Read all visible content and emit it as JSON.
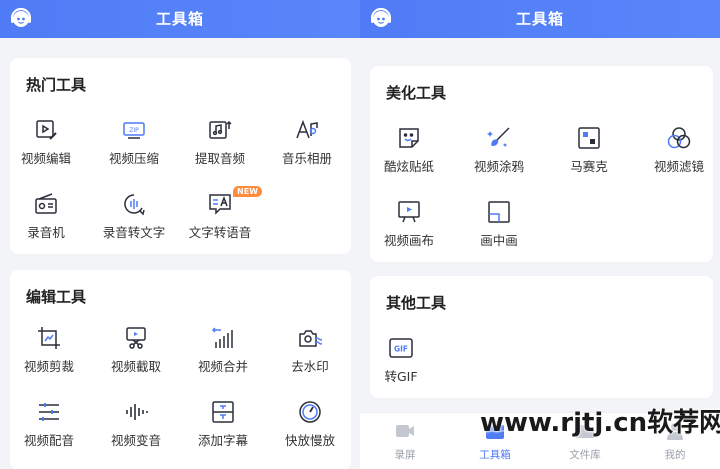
{
  "left": {
    "header_title": "工具箱",
    "hot": {
      "title": "热门工具",
      "items": [
        "视频编辑",
        "视频压缩",
        "提取音频",
        "音乐相册",
        "录音机",
        "录音转文字",
        "文字转语音"
      ],
      "new_badge": "NEW"
    },
    "edit": {
      "title": "编辑工具",
      "items": [
        "视频剪裁",
        "视频截取",
        "视频合并",
        "去水印",
        "视频配音",
        "视频变音",
        "添加字幕",
        "快放慢放"
      ]
    }
  },
  "right": {
    "header_title": "工具箱",
    "beauty": {
      "title": "美化工具",
      "items": [
        "酷炫贴纸",
        "视频涂鸦",
        "马赛克",
        "视频滤镜",
        "视频画布",
        "画中画"
      ]
    },
    "other": {
      "title": "其他工具",
      "items": [
        "转GIF"
      ],
      "gif_icon_text": "GIF"
    },
    "tabbar": {
      "items": [
        "录屏",
        "工具箱",
        "文件库",
        "我的"
      ],
      "active_index": 1
    }
  },
  "icons": {
    "hot": [
      "video-edit-icon",
      "zip-icon",
      "audio-extract-icon",
      "music-album-icon",
      "radio-icon",
      "speech-to-text-icon",
      "text-to-speech-icon"
    ],
    "edit": [
      "crop-icon",
      "scissors-icon",
      "merge-icon",
      "watermark-remove-icon",
      "dub-icon",
      "voice-change-icon",
      "subtitle-icon",
      "speed-icon"
    ]
  },
  "colors": {
    "accent": "#4f7bf6",
    "badge": "#ff8c3a",
    "background": "#f3f4f8",
    "icon_stroke": "#2b2f3a"
  },
  "watermark": "www.rjtj.cn软荐网"
}
